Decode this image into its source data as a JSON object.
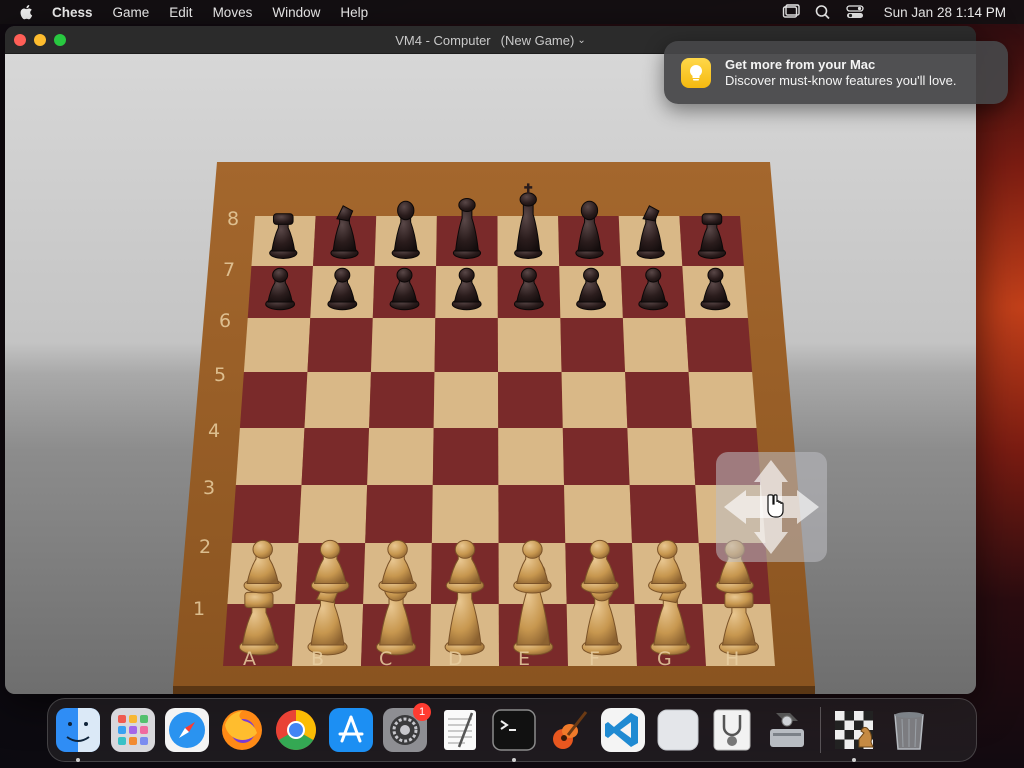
{
  "menubar": {
    "app_name": "Chess",
    "items": [
      "Game",
      "Edit",
      "Moves",
      "Window",
      "Help"
    ],
    "clock": "Sun Jan 28  1:14 PM"
  },
  "window": {
    "title": "VM4 - Computer",
    "subtitle": "(New Game)",
    "title_chevron": "⌄"
  },
  "board": {
    "ranks": [
      "8",
      "7",
      "6",
      "5",
      "4",
      "3",
      "2",
      "1"
    ],
    "files": [
      "A",
      "B",
      "C",
      "D",
      "E",
      "F",
      "G",
      "H"
    ],
    "dark_square_color": "#7a2a2a",
    "light_square_color": "#d9b887",
    "position": {
      "8": [
        "r",
        "n",
        "b",
        "q",
        "k",
        "b",
        "n",
        "r"
      ],
      "7": [
        "p",
        "p",
        "p",
        "p",
        "p",
        "p",
        "p",
        "p"
      ],
      "2": [
        "P",
        "P",
        "P",
        "P",
        "P",
        "P",
        "P",
        "P"
      ],
      "1": [
        "R",
        "N",
        "B",
        "Q",
        "K",
        "B",
        "N",
        "R"
      ]
    }
  },
  "notification": {
    "heading": "Get more from your Mac",
    "body": "Discover must-know features you'll love."
  },
  "dock": {
    "apps": [
      {
        "name": "Finder",
        "running": true
      },
      {
        "name": "Launchpad",
        "running": false
      },
      {
        "name": "Safari",
        "running": false
      },
      {
        "name": "Firefox",
        "running": false
      },
      {
        "name": "Chrome",
        "running": false
      },
      {
        "name": "App Store",
        "running": false
      },
      {
        "name": "System Settings",
        "running": false,
        "badge": "1"
      },
      {
        "name": "TextEdit",
        "running": false
      },
      {
        "name": "Terminal",
        "running": true
      },
      {
        "name": "GarageBand",
        "running": false
      },
      {
        "name": "Visual Studio Code",
        "running": false
      },
      {
        "name": "Blank App",
        "running": false
      },
      {
        "name": "Preview",
        "running": false
      },
      {
        "name": "Disk Utility",
        "running": false
      },
      {
        "name": "Chess",
        "running": true
      },
      {
        "name": "Trash",
        "running": false
      }
    ]
  }
}
